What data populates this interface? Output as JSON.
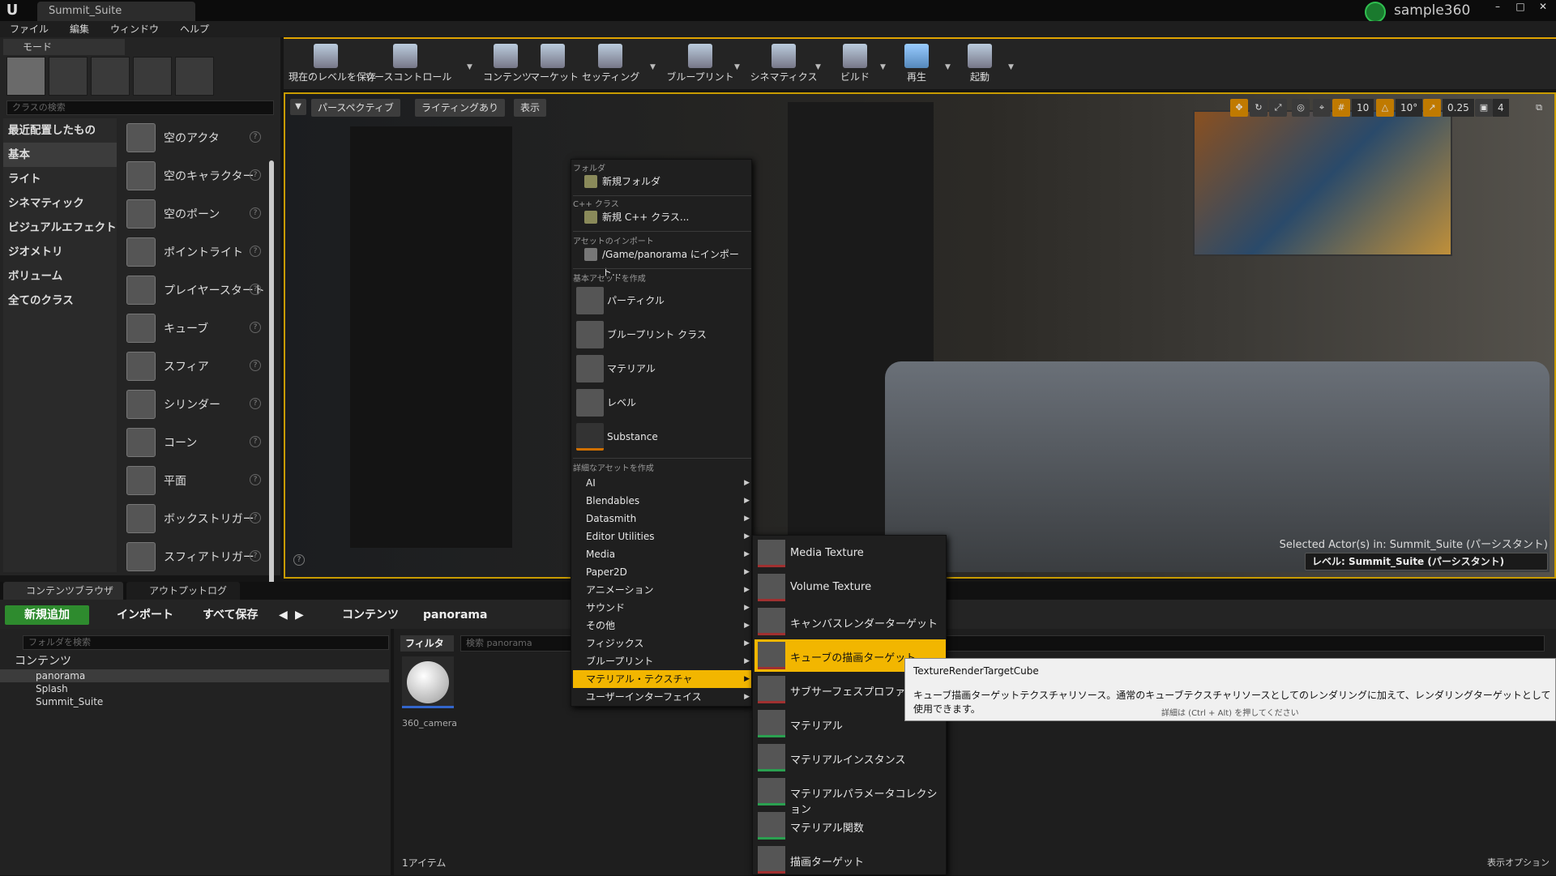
{
  "window": {
    "doc_tab": "Summit_Suite",
    "user": "sample360",
    "min": "–",
    "max": "□",
    "close": "✕",
    "logo": "U"
  },
  "menubar": {
    "items": [
      "ファイル",
      "編集",
      "ウィンドウ",
      "ヘルプ"
    ]
  },
  "modes": {
    "tab_label": "モード",
    "search_placeholder": "クラスの検索",
    "categories": [
      "最近配置したもの",
      "基本",
      "ライト",
      "シネマティック",
      "ビジュアルエフェクト",
      "ジオメトリ",
      "ボリューム",
      "全てのクラス"
    ],
    "selected_category": "基本",
    "items": [
      "空のアクタ",
      "空のキャラクター",
      "空のポーン",
      "ポイントライト",
      "プレイヤースタート",
      "キューブ",
      "スフィア",
      "シリンダー",
      "コーン",
      "平面",
      "ボックストリガー",
      "スフィアトリガー"
    ]
  },
  "toolbar": {
    "buttons": [
      "現在のレベルを保存",
      "ソースコントロール",
      "コンテンツ",
      "マーケット",
      "セッティング",
      "ブループリント",
      "シネマティクス",
      "ビルド",
      "再生",
      "起動"
    ]
  },
  "viewport": {
    "perspective": "パースペクティブ",
    "lighting": "ライティングあり",
    "show": "表示",
    "grid_snap": "10",
    "rot_snap": "10°",
    "scale_snap": "0.25",
    "cam_speed": "4",
    "selected_actor": "Selected Actor(s) in: Summit_Suite (パーシスタント)",
    "level": "レベル:  Summit_Suite (パーシスタント)"
  },
  "bottom_tabs": {
    "content_browser": "コンテンツブラウザ",
    "output_log": "アウトプットログ"
  },
  "content_browser": {
    "add_new": "新規追加",
    "import": "インポート",
    "save_all": "すべて保存",
    "path_root": "コンテンツ",
    "path_current": "panorama",
    "folder_search_placeholder": "フォルダを検索",
    "folders": [
      "コンテンツ",
      "panorama",
      "Splash",
      "Summit_Suite"
    ],
    "filter": "フィルタ",
    "asset_search_placeholder": "検索 panorama",
    "asset_name": "360_camera",
    "item_count": "1アイテム",
    "view_options": "表示オプション"
  },
  "context_menu": {
    "folder_header": "フォルダ",
    "new_folder": "新規フォルダ",
    "cpp_header": "C++ クラス",
    "new_cpp": "新規 C++ クラス...",
    "import_header": "アセットのインポート",
    "import_to": "/Game/panorama にインポート...",
    "basic_header": "基本アセットを作成",
    "basic_items": [
      "パーティクル",
      "ブループリント クラス",
      "マテリアル",
      "レベル",
      "Substance"
    ],
    "advanced_header": "詳細なアセットを作成",
    "advanced_items": [
      "AI",
      "Blendables",
      "Datasmith",
      "Editor Utilities",
      "Media",
      "Paper2D",
      "アニメーション",
      "サウンド",
      "その他",
      "フィジックス",
      "ブループリント",
      "マテリアル・テクスチャ",
      "ユーザーインターフェイス"
    ],
    "highlighted": "マテリアル・テクスチャ"
  },
  "submenu": {
    "items": [
      "Media Texture",
      "Volume Texture",
      "キャンバスレンダーターゲット",
      "キューブの描画ターゲット",
      "サブサーフェスプロファイル",
      "マテリアル",
      "マテリアルインスタンス",
      "マテリアルパラメータコレクション",
      "マテリアル関数",
      "描画ターゲット"
    ],
    "highlighted": "キューブの描画ターゲット"
  },
  "tooltip": {
    "title": "TextureRenderTargetCube",
    "description": "キューブ描画ターゲットテクスチャリソース。通常のキューブテクスチャリソースとしてのレンダリングに加えて、レンダリングターゲットとして使用できます。",
    "hint": "詳細は (Ctrl + Alt) を押してください"
  },
  "colors": {
    "accent": "#f2b600",
    "add_new": "#2e8b2e",
    "viewport_border": "#c89b00"
  }
}
